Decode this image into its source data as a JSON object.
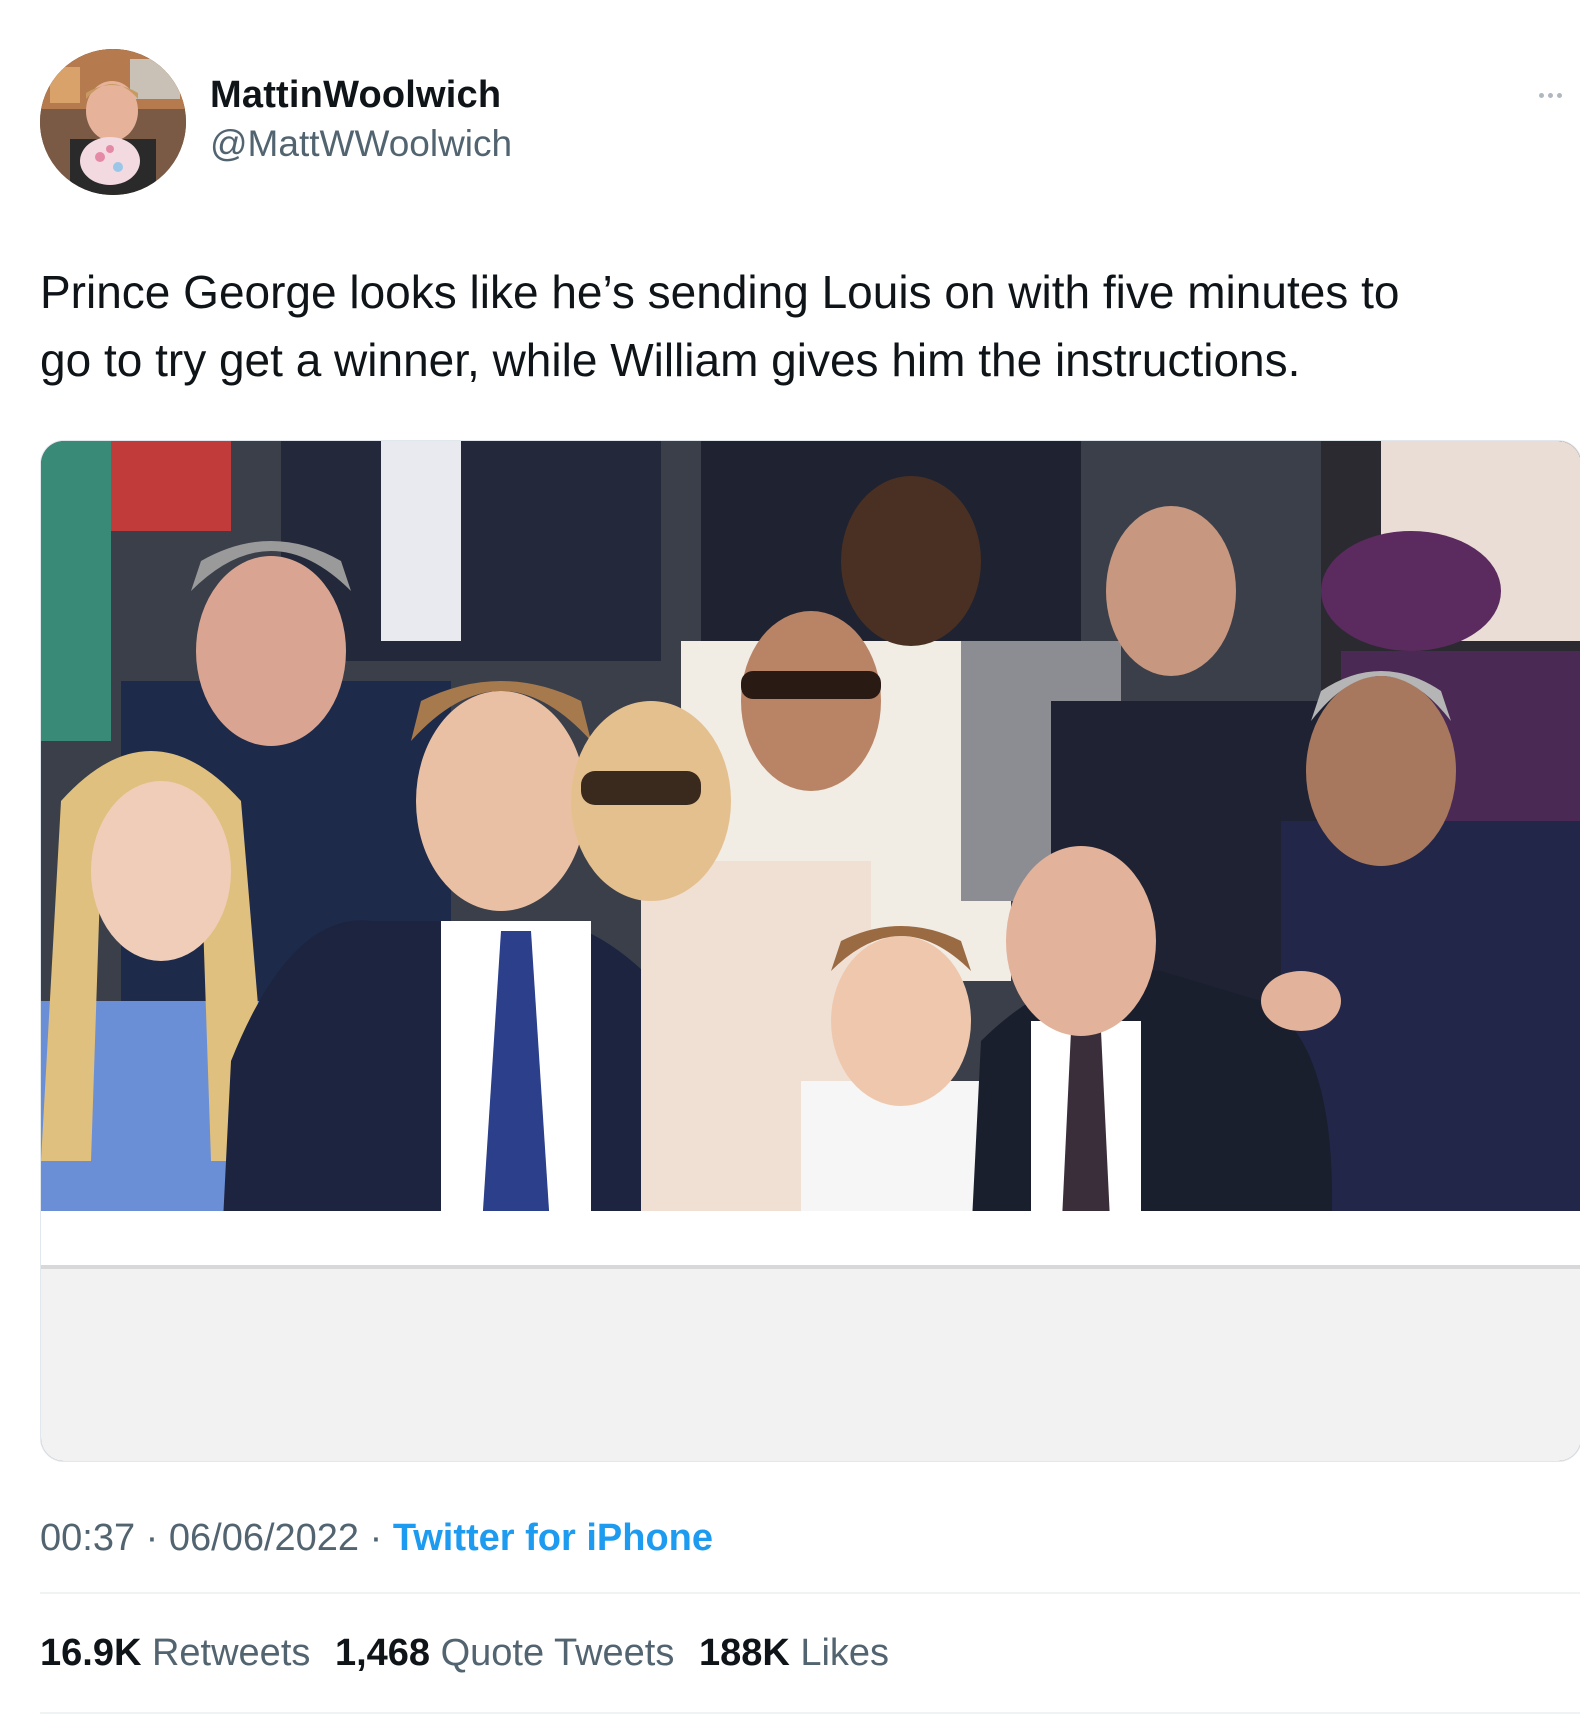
{
  "author": {
    "name": "MattinWoolwich",
    "handle": "@MattWWoolwich"
  },
  "tweet": {
    "text": "Prince George looks like he’s sending Louis on with five minutes to\ngo to try get a winner, while William gives him the instructions."
  },
  "meta": {
    "time": "00:37",
    "separator": "·",
    "date": "06/06/2022",
    "source": "Twitter for iPhone"
  },
  "stats": {
    "retweets_count": "16.9K",
    "retweets_label": "Retweets",
    "quotes_count": "1,468",
    "quotes_label": "Quote Tweets",
    "likes_count": "188K",
    "likes_label": "Likes"
  },
  "colors": {
    "link": "#1d9bf0",
    "secondary_text": "#536471",
    "primary_text": "#0f1419"
  }
}
